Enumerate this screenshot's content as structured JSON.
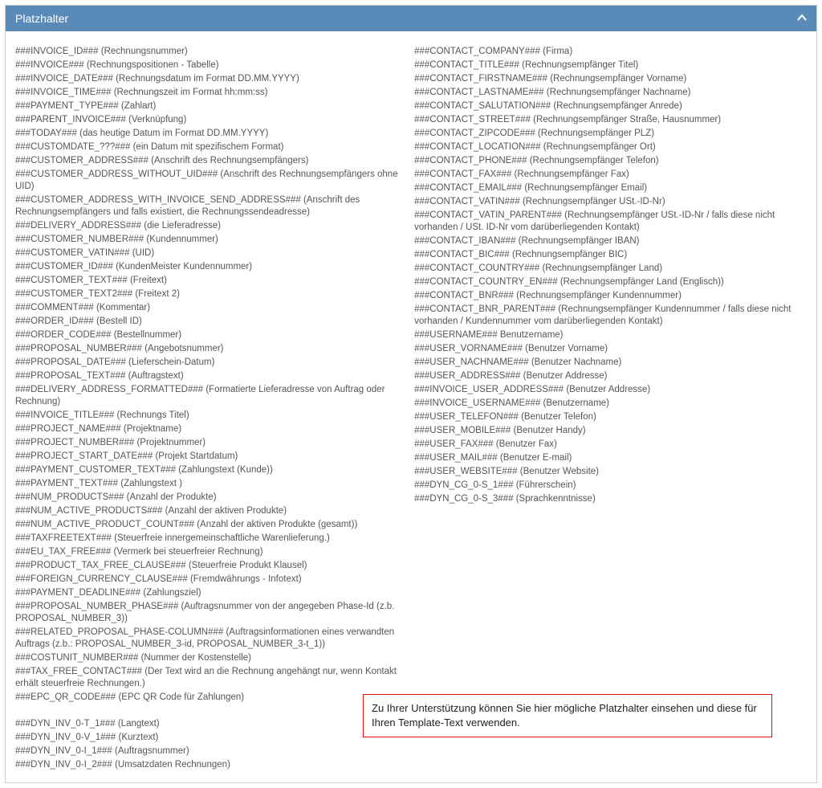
{
  "panel": {
    "title": "Platzhalter",
    "collapse_icon": "chevron-up-icon"
  },
  "columns": {
    "left": [
      "###INVOICE_ID### (Rechnungsnummer)",
      "###INVOICE### (Rechnungspositionen - Tabelle)",
      "###INVOICE_DATE### (Rechnungsdatum im Format DD.MM.YYYY)",
      "###INVOICE_TIME### (Rechnungszeit im Format hh:mm:ss)",
      "###PAYMENT_TYPE### (Zahlart)",
      "###PARENT_INVOICE### (Verknüpfung)",
      "###TODAY### (das heutige Datum im Format DD.MM.YYYY)",
      "###CUSTOMDATE_???### (ein Datum mit spezifischem Format)",
      "###CUSTOMER_ADDRESS### (Anschrift des Rechnungsempfängers)",
      "###CUSTOMER_ADDRESS_WITHOUT_UID### (Anschrift des Rechnungsempfängers ohne UID)",
      "###CUSTOMER_ADDRESS_WITH_INVOICE_SEND_ADDRESS### (Anschrift des Rechnungsempfängers und falls existiert, die Rechnungssendeadresse)",
      "###DELIVERY_ADDRESS### (die Lieferadresse)",
      "###CUSTOMER_NUMBER### (Kundennummer)",
      "###CUSTOMER_VATIN### (UID)",
      "###CUSTOMER_ID### (KundenMeister Kundennummer)",
      "###CUSTOMER_TEXT### (Freitext)",
      "###CUSTOMER_TEXT2### (Freitext 2)",
      "###COMMENT### (Kommentar)",
      "###ORDER_ID### (Bestell ID)",
      "###ORDER_CODE### (Bestellnummer)",
      "###PROPOSAL_NUMBER### (Angebotsnummer)",
      "###PROPOSAL_DATE### (Lieferschein-Datum)",
      "###PROPOSAL_TEXT### (Auftragstext)",
      "###DELIVERY_ADDRESS_FORMATTED### (Formatierte Lieferadresse von Auftrag oder Rechnung)",
      "###INVOICE_TITLE### (Rechnungs Titel)",
      "###PROJECT_NAME### (Projektname)",
      "###PROJECT_NUMBER### (Projektnummer)",
      "###PROJECT_START_DATE### (Projekt Startdatum)",
      "###PAYMENT_CUSTOMER_TEXT### (Zahlungstext (Kunde))",
      "###PAYMENT_TEXT### (Zahlungstext )",
      "###NUM_PRODUCTS### (Anzahl der Produkte)",
      "###NUM_ACTIVE_PRODUCTS### (Anzahl der aktiven Produkte)",
      "###NUM_ACTIVE_PRODUCT_COUNT### (Anzahl der aktiven Produkte (gesamt))",
      "###TAXFREETEXT### (Steuerfreie innergemeinschaftliche Warenlieferung.)",
      "###EU_TAX_FREE### (Vermerk bei steuerfreier Rechnung)",
      "###PRODUCT_TAX_FREE_CLAUSE### (Steuerfreie Produkt Klausel)",
      "###FOREIGN_CURRENCY_CLAUSE### (Fremdwährungs - Infotext)",
      "###PAYMENT_DEADLINE### (Zahlungsziel)",
      "###PROPOSAL_NUMBER_PHASE### (Auftragsnummer von der angegeben Phase-Id (z.b. PROPOSAL_NUMBER_3))",
      "###RELATED_PROPOSAL_PHASE-COLUMN### (Auftragsinformationen eines verwandten Auftrags (z.b.: PROPOSAL_NUMBER_3-id, PROPOSAL_NUMBER_3-t_1))",
      "###COSTUNIT_NUMBER### (Nummer der Kostenstelle)",
      "###TAX_FREE_CONTACT### (Der Text wird an die Rechnung angehängt nur, wenn Kontakt erhält steuerfreie Rechnungen.)",
      "###EPC_QR_CODE### (EPC QR Code für Zahlungen)",
      "",
      "###DYN_INV_0-T_1### (Langtext)",
      "###DYN_INV_0-V_1### (Kurztext)",
      "###DYN_INV_0-I_1### (Auftragsnummer)",
      "###DYN_INV_0-I_2### (Umsatzdaten Rechnungen)"
    ],
    "right": [
      "###CONTACT_COMPANY### (Firma)",
      "###CONTACT_TITLE### (Rechnungsempfänger Titel)",
      "###CONTACT_FIRSTNAME### (Rechnungsempfänger Vorname)",
      "###CONTACT_LASTNAME### (Rechnungsempfänger Nachname)",
      "###CONTACT_SALUTATION### (Rechnungsempfänger Anrede)",
      "###CONTACT_STREET### (Rechnungsempfänger Straße, Hausnummer)",
      "###CONTACT_ZIPCODE### (Rechnungsempfänger PLZ)",
      "###CONTACT_LOCATION### (Rechnungsempfänger Ort)",
      "###CONTACT_PHONE### (Rechnungsempfänger Telefon)",
      "###CONTACT_FAX### (Rechnungsempfänger Fax)",
      "###CONTACT_EMAIL### (Rechnungsempfänger Email)",
      "###CONTACT_VATIN### (Rechnungsempfänger USt.-ID-Nr)",
      "###CONTACT_VATIN_PARENT### (Rechnungsempfänger USt.-ID-Nr / falls diese nicht vorhanden / USt. ID-Nr vom darüberliegenden Kontakt)",
      "###CONTACT_IBAN### (Rechnungsempfänger IBAN)",
      "###CONTACT_BIC### (Rechnungsempfänger BIC)",
      "###CONTACT_COUNTRY### (Rechnungsempfänger Land)",
      "###CONTACT_COUNTRY_EN### (Rechnungsempfänger Land (Englisch))",
      "###CONTACT_BNR### (Rechnungsempfänger Kundennummer)",
      "###CONTACT_BNR_PARENT### (Rechnungsempfänger Kundennummer / falls diese nicht vorhanden / Kundennummer vom darüberliegenden Kontakt)",
      "###USERNAME### Benutzername)",
      "###USER_VORNAME### (Benutzer Vorname)",
      "###USER_NACHNAME### (Benutzer Nachname)",
      "###USER_ADDRESS### (Benutzer Addresse)",
      "###INVOICE_USER_ADDRESS### (Benutzer Addresse)",
      "###INVOICE_USERNAME### (Benutzername)",
      "###USER_TELEFON### (Benutzer Telefon)",
      "###USER_MOBILE### (Benutzer Handy)",
      "###USER_FAX### (Benutzer Fax)",
      "###USER_MAIL### (Benutzer E-mail)",
      "###USER_WEBSITE### (Benutzer Website)",
      "###DYN_CG_0-S_1### (Führerschein)",
      "###DYN_CG_0-S_3### (Sprachkenntnisse)"
    ]
  },
  "callout": {
    "text": "Zu Ihrer Unterstützung können Sie hier mögliche Platzhalter einsehen und diese für Ihren Template-Text verwenden."
  }
}
